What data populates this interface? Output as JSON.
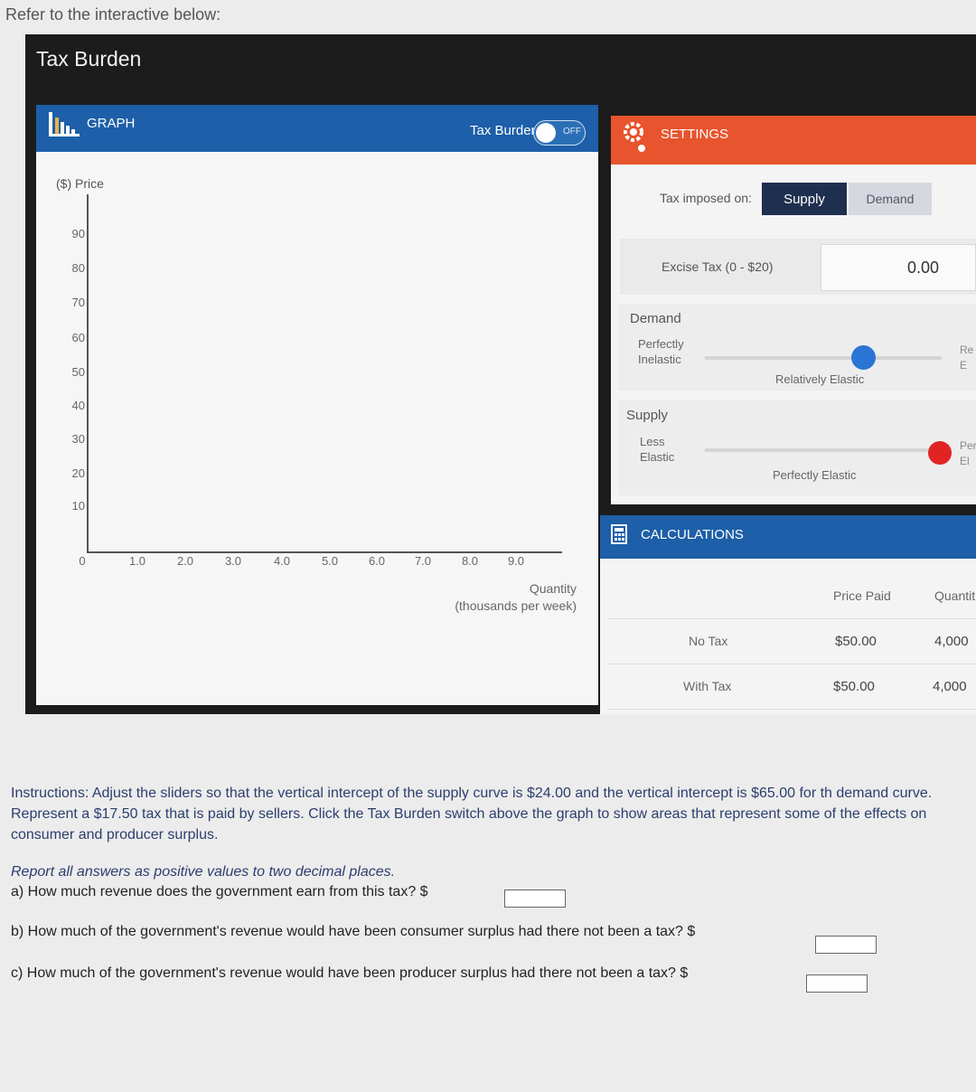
{
  "intro_text": "Refer to the interactive below:",
  "app_title": "Tax Burden",
  "graph": {
    "header_label": "GRAPH",
    "tax_burden_label": "Tax Burden",
    "toggle_state": "OFF",
    "y_axis_label": "($) Price",
    "y_ticks": [
      "90",
      "80",
      "70",
      "60",
      "50",
      "40",
      "30",
      "20",
      "10"
    ],
    "x_ticks": [
      "0",
      "1.0",
      "2.0",
      "3.0",
      "4.0",
      "5.0",
      "6.0",
      "7.0",
      "8.0",
      "9.0"
    ],
    "x_axis_label_line1": "Quantity",
    "x_axis_label_line2": "(thousands per week)"
  },
  "settings": {
    "header_label": "SETTINGS",
    "tax_imposed_label": "Tax imposed on:",
    "supply_button": "Supply",
    "demand_button": "Demand",
    "excise_label": "Excise Tax (0 - $20)",
    "excise_value": "0.00",
    "demand": {
      "title": "Demand",
      "left_line1": "Perfectly",
      "left_line2": "Inelastic",
      "middle_label": "Relatively Elastic",
      "right_line1": "Re",
      "right_line2": "E"
    },
    "supply": {
      "title": "Supply",
      "left_line1": "Less",
      "left_line2": "Elastic",
      "middle_label": "Perfectly Elastic",
      "right_line1": "Per",
      "right_line2": "El"
    }
  },
  "calculations": {
    "header_label": "CALCULATIONS",
    "col_price": "Price Paid",
    "col_quantity": "Quantit",
    "rows": [
      {
        "label": "No Tax",
        "price": "$50.00",
        "quantity": "4,000"
      },
      {
        "label": "With Tax",
        "price": "$50.00",
        "quantity": "4,000"
      }
    ]
  },
  "instructions": "Instructions: Adjust the sliders so that the vertical intercept of the supply curve is $24.00 and the vertical intercept is $65.00 for th demand curve. Represent a $17.50 tax that is paid by sellers. Click the Tax Burden switch above the graph to show areas that represent some of the effects on consumer and producer surplus.",
  "report_note": "Report all answers as positive values to two decimal places.",
  "questions": {
    "a": "a) How much revenue does the government earn from this tax?  $",
    "b": "b) How much of the government's revenue would have been consumer surplus had there not been a tax?  $",
    "c": "c) How much of the government's revenue would have been producer surplus had there not been a tax?  $"
  },
  "colors": {
    "graph_header": "#1d5fa8",
    "settings_header": "#e8542d",
    "demand_knob": "#2a75d3",
    "supply_knob": "#e02424"
  }
}
